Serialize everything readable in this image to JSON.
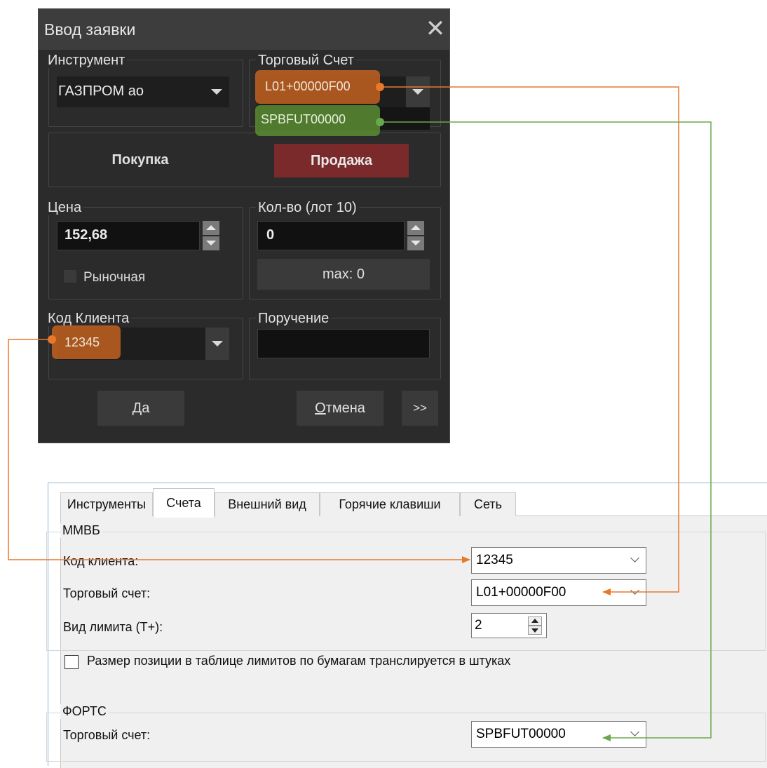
{
  "colors": {
    "orange": "#e8792a",
    "green": "#6aa84f",
    "sell_red": "#7a2a2a"
  },
  "dialog": {
    "title": "Ввод заявки",
    "close_icon": "close-icon",
    "instrument": {
      "label": "Инструмент",
      "value": "ГАЗПРОМ ао"
    },
    "account": {
      "label": "Торговый Счет",
      "value": "L01+00000F00",
      "alt_value": "SPBFUT00000"
    },
    "buy_label": "Покупка",
    "sell_label": "Продажа",
    "price": {
      "label": "Цена",
      "value": "152,68",
      "market_label": "Рыночная"
    },
    "qty": {
      "label": "Кол-во (лот 10)",
      "value": "0",
      "max_label": "max: 0"
    },
    "client_code": {
      "label": "Код Клиента",
      "value": "12345"
    },
    "instruction": {
      "label": "Поручение",
      "value": ""
    },
    "ok": {
      "accel": "Д",
      "rest": "а"
    },
    "cancel": {
      "accel": "О",
      "rest": "тмена"
    },
    "more_label": ">>"
  },
  "settings": {
    "tabs": [
      "Инструменты",
      "Счета",
      "Внешний вид",
      "Горячие клавиши",
      "Сеть"
    ],
    "active_tab": "Счета",
    "mmvb": {
      "title": "ММВБ",
      "client_code_label": "Код клиента:",
      "client_code_value": "12345",
      "account_label": "Торговый счет:",
      "account_value": "L01+00000F00",
      "limit_label": "Вид лимита (T+):",
      "limit_value": "2",
      "checkbox_label": "Размер позиции в таблице лимитов по бумагам транслируется в штуках"
    },
    "forts": {
      "title": "ФОРТС",
      "account_label": "Торговый счет:",
      "account_value": "SPBFUT00000"
    }
  }
}
